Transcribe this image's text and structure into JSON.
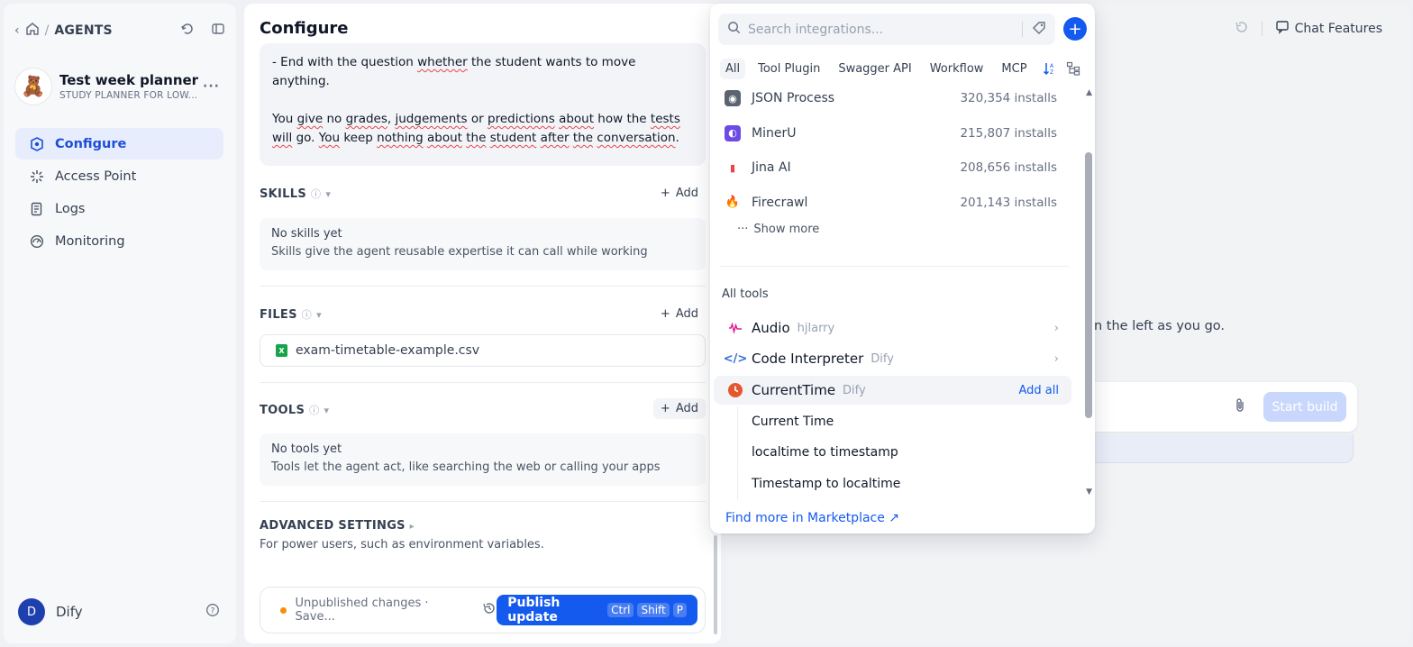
{
  "sidebar": {
    "crumb": "AGENTS",
    "app": {
      "name": "Test week planner",
      "subtitle": "STUDY PLANNER FOR LOW..."
    },
    "nav": [
      {
        "label": "Configure"
      },
      {
        "label": "Access Point"
      },
      {
        "label": "Logs"
      },
      {
        "label": "Monitoring"
      }
    ],
    "user": {
      "initial": "D",
      "name": "Dify"
    }
  },
  "config": {
    "title": "Configure",
    "prompt": {
      "line1": "- End with the question whether the student wants to move anything.",
      "para2": "You give no grades, judgements or predictions about how the tests will go. You keep nothing about the student after the conversation."
    },
    "skills": {
      "title": "SKILLS",
      "add": "Add",
      "empty_title": "No skills yet",
      "empty_desc": "Skills give the agent reusable expertise it can call while working"
    },
    "files": {
      "title": "FILES",
      "add": "Add",
      "file_name": "exam-timetable-example.csv"
    },
    "tools": {
      "title": "TOOLS",
      "add": "Add",
      "empty_title": "No tools yet",
      "empty_desc": "Tools let the agent act, like searching the web or calling your apps"
    },
    "advanced": {
      "title": "ADVANCED SETTINGS",
      "desc": "For power users, such as environment variables."
    },
    "publish": {
      "status": "Unpublished changes · Save...",
      "button": "Publish update",
      "keys": [
        "Ctrl",
        "Shift",
        "P"
      ]
    }
  },
  "right": {
    "chat_features": "Chat Features",
    "hint": "n the left as you go.",
    "start_build": "Start build"
  },
  "dropdown": {
    "search_placeholder": "Search integrations...",
    "tabs": [
      "All",
      "Tool Plugin",
      "Swagger API",
      "Workflow",
      "MCP"
    ],
    "plugins": [
      {
        "name": "JSON Process",
        "installs": "320,354 installs"
      },
      {
        "name": "MinerU",
        "installs": "215,807 installs"
      },
      {
        "name": "Jina AI",
        "installs": "208,656 installs"
      },
      {
        "name": "Firecrawl",
        "installs": "201,143 installs"
      }
    ],
    "show_more": "Show more",
    "all_tools_label": "All tools",
    "tools": [
      {
        "name": "Audio",
        "author": "hjlarry"
      },
      {
        "name": "Code Interpreter",
        "author": "Dify"
      },
      {
        "name": "CurrentTime",
        "author": "Dify",
        "action": "Add all"
      }
    ],
    "subtools": [
      "Current Time",
      "localtime to timestamp",
      "Timestamp to localtime"
    ],
    "marketplace": "Find more in Marketplace ↗"
  }
}
